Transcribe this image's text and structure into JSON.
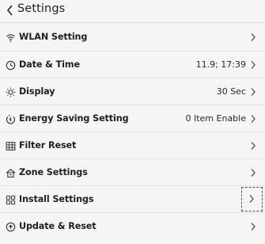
{
  "header": {
    "title": "Settings"
  },
  "items": [
    {
      "icon": "wifi-icon",
      "label": "WLAN Setting",
      "value": ""
    },
    {
      "icon": "clock-icon",
      "label": "Date & Time",
      "value": "11.9; 17:39"
    },
    {
      "icon": "sun-icon",
      "label": "Display",
      "value": "30 Sec"
    },
    {
      "icon": "energy-icon",
      "label": "Energy Saving Setting",
      "value": "0 Item Enable"
    },
    {
      "icon": "grid-icon",
      "label": "Filter Reset",
      "value": ""
    },
    {
      "icon": "home-icon",
      "label": "Zone Settings",
      "value": ""
    },
    {
      "icon": "apps-icon",
      "label": "Install Settings",
      "value": ""
    },
    {
      "icon": "update-icon",
      "label": "Update & Reset",
      "value": ""
    }
  ]
}
